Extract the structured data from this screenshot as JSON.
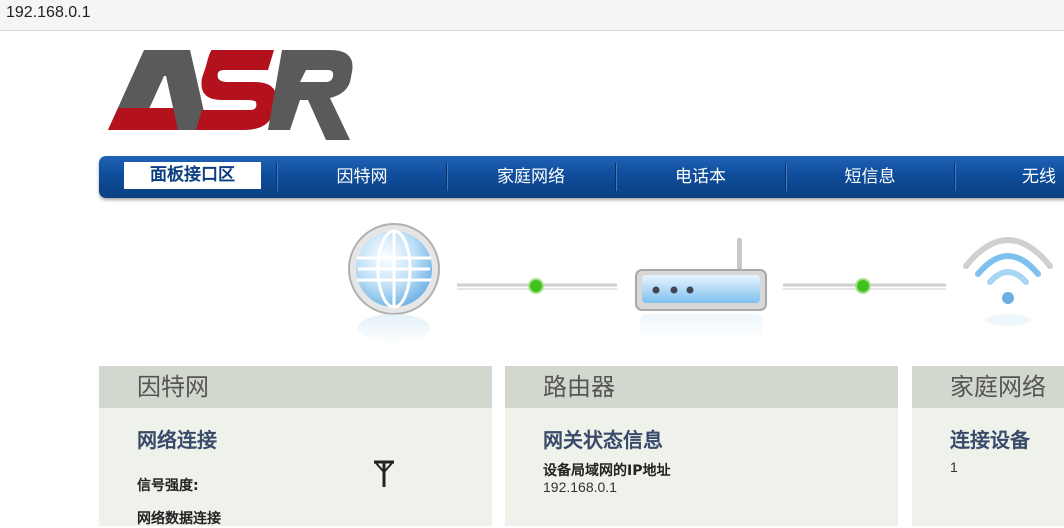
{
  "browser": {
    "url": "192.168.0.1"
  },
  "logo": {
    "text": "ASR",
    "colors": {
      "red": "#b3121d",
      "gray": "#5a5a5a"
    }
  },
  "nav": {
    "items": [
      "面板接口区",
      "因特网",
      "家庭网络",
      "电话本",
      "短信息",
      "无线"
    ],
    "active_index": 0
  },
  "diagram": {
    "icons": [
      "globe-icon",
      "router-icon",
      "wifi-icon"
    ],
    "link_status_color": "#3ec21c"
  },
  "panels": {
    "internet": {
      "title": "因特网",
      "subtitle": "网络连接",
      "signal_label": "信号强度:",
      "data_label": "网络数据连接"
    },
    "router": {
      "title": "路由器",
      "subtitle": "网关状态信息",
      "ip_label": "设备局域网的IP地址",
      "ip_value": "192.168.0.1"
    },
    "home": {
      "title": "家庭网络",
      "subtitle": "连接设备",
      "devices_value": "1"
    }
  }
}
